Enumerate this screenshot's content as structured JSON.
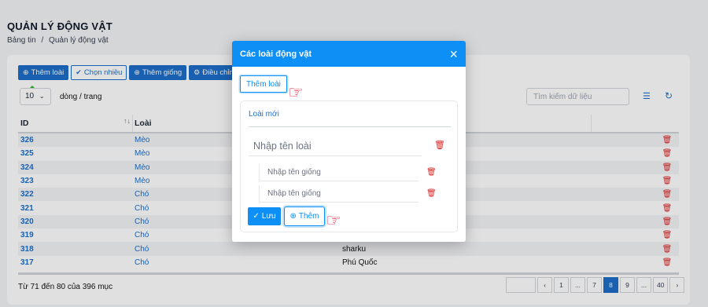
{
  "page": {
    "title": "QUẢN LÝ ĐỘNG VẬT",
    "breadcrumb": [
      "Bảng tin",
      "/",
      "Quản lý động vật"
    ]
  },
  "toolbar": {
    "add_species": "Thêm loài",
    "multi_select": "Chọn nhiều",
    "add_breed": "Thêm giống",
    "adjust": "Điều chỉnh"
  },
  "list": {
    "page_size": "10",
    "page_size_label": "dòng / trang",
    "search_placeholder": "Tìm kiếm dữ liệu"
  },
  "table": {
    "headers": {
      "id": "ID",
      "species": "Loài"
    },
    "rows": [
      {
        "id": "326",
        "species": "Mèo",
        "breed": ""
      },
      {
        "id": "325",
        "species": "Mèo",
        "breed": ""
      },
      {
        "id": "324",
        "species": "Mèo",
        "breed": ""
      },
      {
        "id": "323",
        "species": "Mèo",
        "breed": ""
      },
      {
        "id": "322",
        "species": "Chó",
        "breed": ""
      },
      {
        "id": "321",
        "species": "Chó",
        "breed": ""
      },
      {
        "id": "320",
        "species": "Chó",
        "breed": ""
      },
      {
        "id": "319",
        "species": "Chó",
        "breed": ""
      },
      {
        "id": "318",
        "species": "Chó",
        "breed": "sharku"
      },
      {
        "id": "317",
        "species": "Chó",
        "breed": "Phú Quốc"
      }
    ]
  },
  "footer": {
    "info": "Từ 71 đến 80 của 396 mục",
    "pages": [
      "1",
      "...",
      "7",
      "8",
      "9",
      "...",
      "40"
    ],
    "active_page": "8",
    "prev": "‹",
    "next": "›"
  },
  "modal": {
    "title": "Các loài động vật",
    "add_species_button": "Thêm loài",
    "new_label": "Loài mới",
    "species_placeholder": "Nhập tên loài",
    "breed_placeholder_1": "Nhập tên giống",
    "breed_placeholder_2": "Nhập tên giống",
    "save_label": "Lưu",
    "add_label": "Thêm"
  },
  "colors": {
    "primary": "#1d6fc9",
    "modal_header": "#0d8ff5",
    "danger": "#dc2626",
    "pointer_hand": "#dc1e3c"
  }
}
